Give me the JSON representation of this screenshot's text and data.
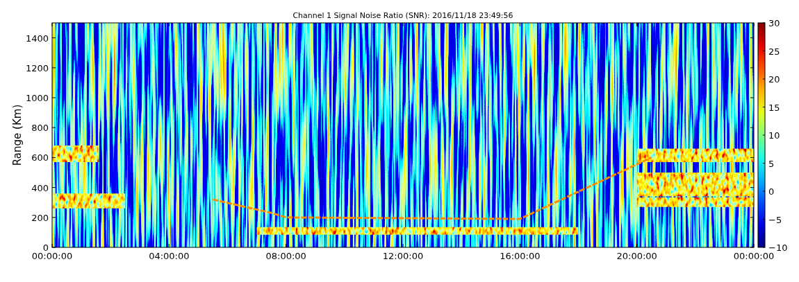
{
  "plot": {
    "title": "Channel 1 Signal Noise Ratio (SNR): 2016/11/18 23:49:56",
    "ylabel": "Range (Km)",
    "xticks": [
      "00:00:00",
      "04:00:00",
      "08:00:00",
      "12:00:00",
      "16:00:00",
      "20:00:00",
      "00:00:00"
    ],
    "yticks": [
      "1400",
      "1200",
      "1000",
      "800",
      "600",
      "400",
      "200",
      "0"
    ]
  },
  "colorbar": {
    "ticks": [
      "30",
      "25",
      "20",
      "15",
      "10",
      "5",
      "0",
      "−5",
      "−10"
    ]
  }
}
